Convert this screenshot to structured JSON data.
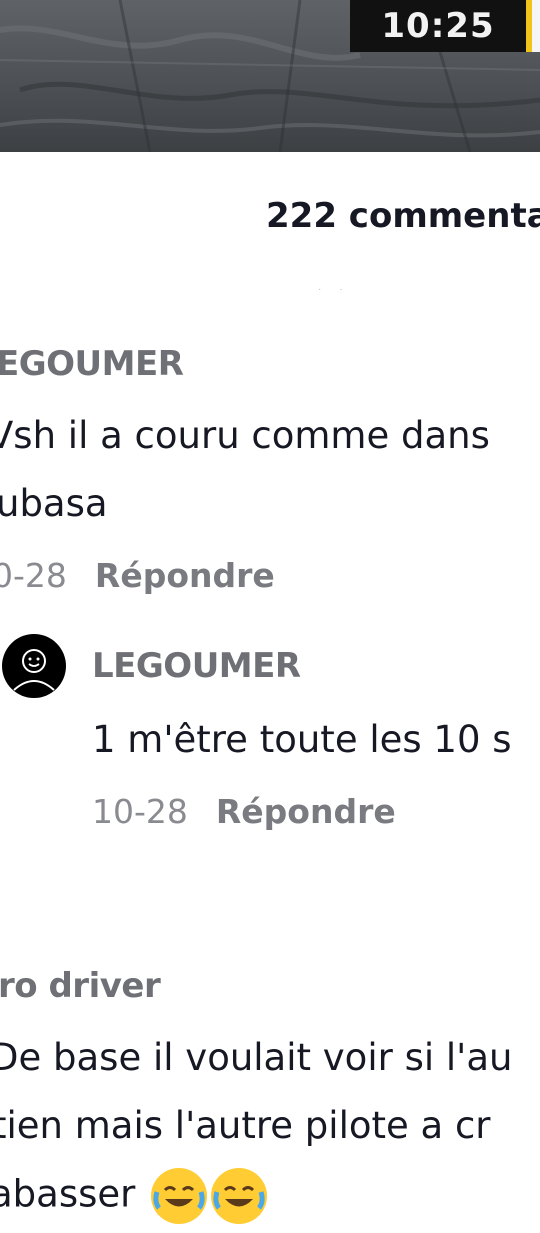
{
  "video": {
    "timestamp": "10:25"
  },
  "comments_header": {
    "count_label": "222 commenta"
  },
  "comments": [
    {
      "username": "EGOUMER",
      "text_lines": [
        "Vsh il a couru comme dans",
        "ubasa"
      ],
      "date": "0-28",
      "reply_label": "Répondre"
    },
    {
      "username": "LEGOUMER",
      "text_lines": [
        "1 m'être toute les 10 s"
      ],
      "date": "10-28",
      "reply_label": "Répondre",
      "avatar_icon": "user-avatar-icon"
    },
    {
      "username": "ro driver",
      "text_lines": [
        "De base il voulait voir si l'au",
        "tien mais l'autre pilote a cr",
        "abasser"
      ]
    }
  ],
  "colors": {
    "text": "#161823",
    "muted": "#8a8b91",
    "username": "#6f7075",
    "timestamp_bg": "#111111",
    "accent_yellow": "#f0c419"
  }
}
